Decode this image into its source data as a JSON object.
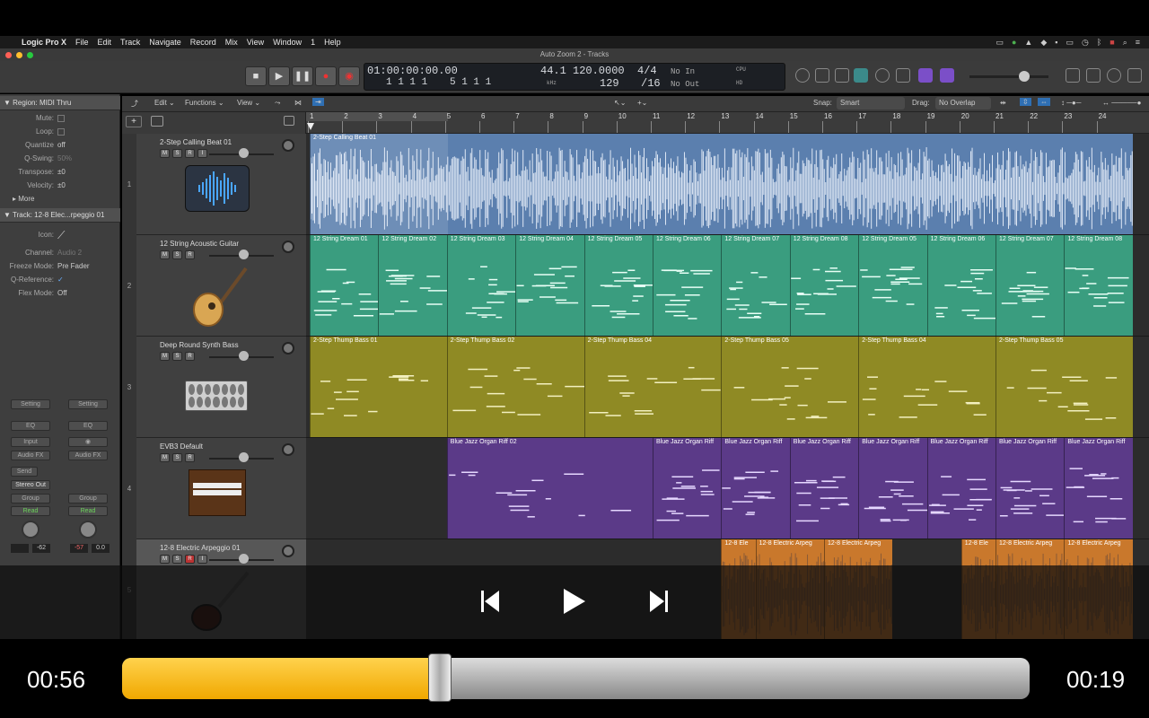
{
  "menubar": {
    "app": "Logic Pro X",
    "items": [
      "File",
      "Edit",
      "Track",
      "Navigate",
      "Record",
      "Mix",
      "View",
      "Window",
      "1",
      "Help"
    ]
  },
  "window_title": "Auto Zoom 2 - Tracks",
  "lcd": {
    "time": "01:00:00:00.00",
    "time_sub": "1  1  1     1",
    "bars": "5  1  1     1",
    "sample_rate": "44.1",
    "sample_rate_unit": "kHz",
    "tempo": "120.0000",
    "tempo_sub": "129",
    "sig": "4/4",
    "div": "/16",
    "in": "No In",
    "out": "No Out",
    "cpu": "CPU",
    "hd": "HD"
  },
  "inspector": {
    "region_header": "Region: MIDI Thru",
    "rows": [
      {
        "label": "Mute:",
        "value": ""
      },
      {
        "label": "Loop:",
        "value": ""
      },
      {
        "label": "Quantize",
        "value": "off"
      },
      {
        "label": "Q-Swing:",
        "value": "50%"
      },
      {
        "label": "Transpose:",
        "value": "±0"
      },
      {
        "label": "Velocity:",
        "value": "±0"
      }
    ],
    "more": "More",
    "track_header_label": "Track:",
    "track_header_value": "12-8 Elec...rpeggio 01",
    "track_rows": [
      {
        "label": "Icon:",
        "value": ""
      },
      {
        "label": "Channel:",
        "value": "Audio 2"
      },
      {
        "label": "Freeze Mode:",
        "value": "Pre Fader"
      },
      {
        "label": "Q-Reference:",
        "value": "✓"
      },
      {
        "label": "Flex Mode:",
        "value": "Off"
      }
    ],
    "strip_left": {
      "setting": "Setting",
      "eq": "EQ",
      "input": "Input",
      "audio_fx": "Audio FX",
      "send": "Send",
      "out": "Stereo Out",
      "group": "Group",
      "read": "Read",
      "v1": "",
      "v2": "-62"
    },
    "strip_right": {
      "setting": "Setting",
      "eq": "EQ",
      "audio_fx": "Audio FX",
      "group": "Group",
      "read": "Read",
      "v1": "-57",
      "v2": "0.0"
    }
  },
  "tracks_bar": {
    "edit": "Edit",
    "functions": "Functions",
    "view": "View",
    "snap_label": "Snap:",
    "snap_value": "Smart",
    "drag_label": "Drag:",
    "drag_value": "No Overlap"
  },
  "ruler": [
    "1",
    "2",
    "3",
    "4",
    "5",
    "6",
    "7",
    "8",
    "9",
    "10",
    "11",
    "12",
    "13",
    "14",
    "15",
    "16",
    "17",
    "18",
    "19",
    "20",
    "21",
    "22",
    "23",
    "24"
  ],
  "tracks": [
    {
      "num": "1",
      "name": "2-Step Calling Beat 01",
      "buttons": [
        "M",
        "S",
        "R",
        "I"
      ],
      "icon": "waveform-icon"
    },
    {
      "num": "2",
      "name": "12 String Acoustic Guitar",
      "buttons": [
        "M",
        "S",
        "R"
      ],
      "icon": "acoustic-guitar-icon"
    },
    {
      "num": "3",
      "name": "Deep Round Synth Bass",
      "buttons": [
        "M",
        "S",
        "R"
      ],
      "icon": "synth-icon"
    },
    {
      "num": "4",
      "name": "EVB3 Default",
      "buttons": [
        "M",
        "S",
        "R"
      ],
      "icon": "organ-icon"
    },
    {
      "num": "5",
      "name": "12-8 Electric Arpeggio 01",
      "buttons": [
        "M",
        "S",
        "R",
        "I"
      ],
      "icon": "electric-guitar-icon"
    }
  ],
  "regions": {
    "lane1": [
      "2-Step Calling Beat 01"
    ],
    "lane2": [
      "12 String Dream 01",
      "12 String Dream 02",
      "12 String Dream 03",
      "12 String Dream 04",
      "12 String Dream 05",
      "12 String Dream 06",
      "12 String Dream 07",
      "12 String Dream 08",
      "12 String Dream 05",
      "12 String Dream 06",
      "12 String Dream 07",
      "12 String Dream 08"
    ],
    "lane3": [
      "2-Step Thump Bass 01",
      "2-Step Thump Bass 02",
      "2-Step Thump Bass 04",
      "2-Step Thump Bass 05",
      "2-Step Thump Bass 04",
      "2-Step Thump Bass 05"
    ],
    "lane4": [
      "Blue Jazz Organ Riff 02",
      "Blue Jazz Organ Riff",
      "Blue Jazz Organ Riff",
      "Blue Jazz Organ Riff",
      "Blue Jazz Organ Riff",
      "Blue Jazz Organ Riff",
      "Blue Jazz Organ Riff",
      "Blue Jazz Organ Riff"
    ],
    "lane5": [
      "12-8 Ele",
      "12-8 Electric Arpeg",
      "12-8 Electric Arpeg",
      "12-8 Ele",
      "12-8 Electric Arpeg",
      "12-8 Electric Arpeg"
    ]
  },
  "player": {
    "elapsed": "00:56",
    "remaining": "00:19",
    "progress": 0.35
  },
  "colors": {
    "audio_blue": "#5b7fae",
    "green": "#3a9d7f",
    "olive": "#8f8a24",
    "purple": "#5b3a88",
    "orange": "#c9782c",
    "progress": "#f5b000"
  }
}
